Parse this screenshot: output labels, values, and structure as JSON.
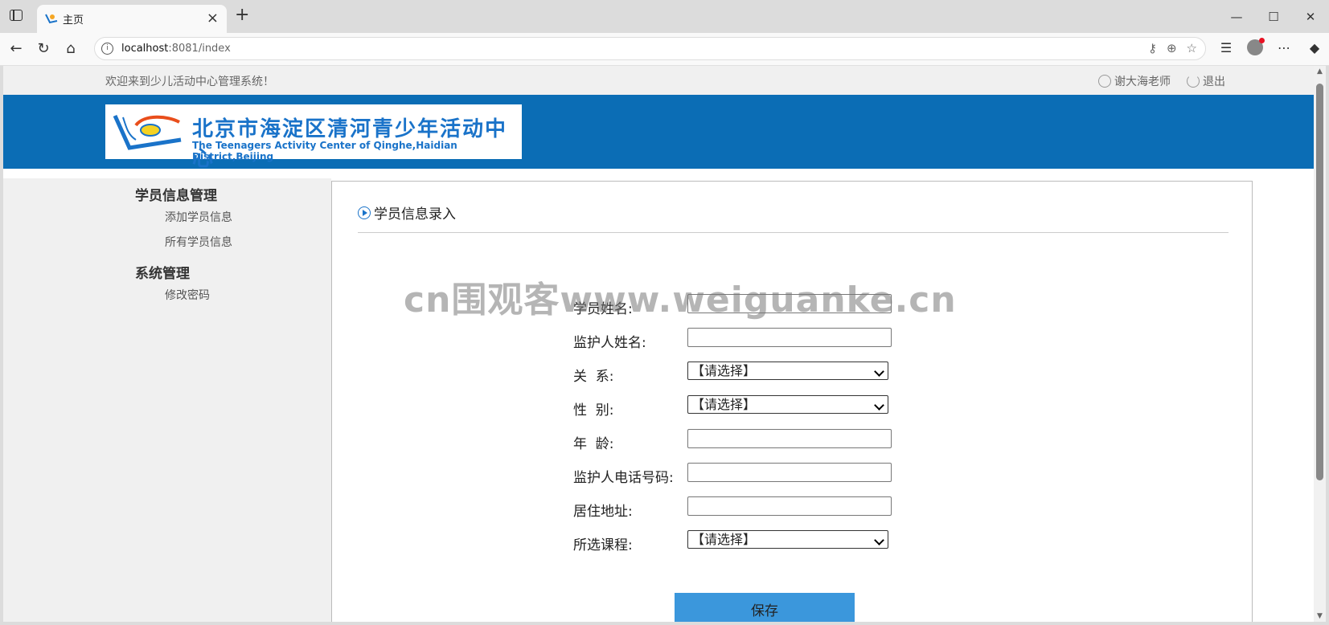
{
  "browser": {
    "tab_title": "主页",
    "url_host": "localhost",
    "url_rest": ":8081/index"
  },
  "site": {
    "welcome": "欢迎来到少儿活动中心管理系统！",
    "user_name": "谢大海老师",
    "logout": "退出",
    "logo_cn": "北京市海淀区清河青少年活动中心",
    "logo_en": "The Teenagers Activity Center of Qinghe,Haidian District,Beijing"
  },
  "sidebar": {
    "sections": [
      {
        "title": "学员信息管理",
        "items": [
          "添加学员信息",
          "所有学员信息"
        ]
      },
      {
        "title": "系统管理",
        "items": [
          "修改密码"
        ]
      }
    ]
  },
  "content": {
    "title": "学员信息录入",
    "fields": [
      {
        "label": "学员姓名:",
        "type": "input",
        "value": ""
      },
      {
        "label": "监护人姓名:",
        "type": "input",
        "value": ""
      },
      {
        "label": "关  系:",
        "type": "select",
        "value": "【请选择】"
      },
      {
        "label": "性  别:",
        "type": "select",
        "value": "【请选择】"
      },
      {
        "label": "年  龄:",
        "type": "input",
        "value": ""
      },
      {
        "label": "监护人电话号码:",
        "type": "input",
        "value": ""
      },
      {
        "label": "居住地址:",
        "type": "input",
        "value": ""
      },
      {
        "label": "所选课程:",
        "type": "select",
        "value": "【请选择】"
      }
    ],
    "save_label": "保存"
  },
  "watermark": "cn围观客www.weiguanke.cn"
}
